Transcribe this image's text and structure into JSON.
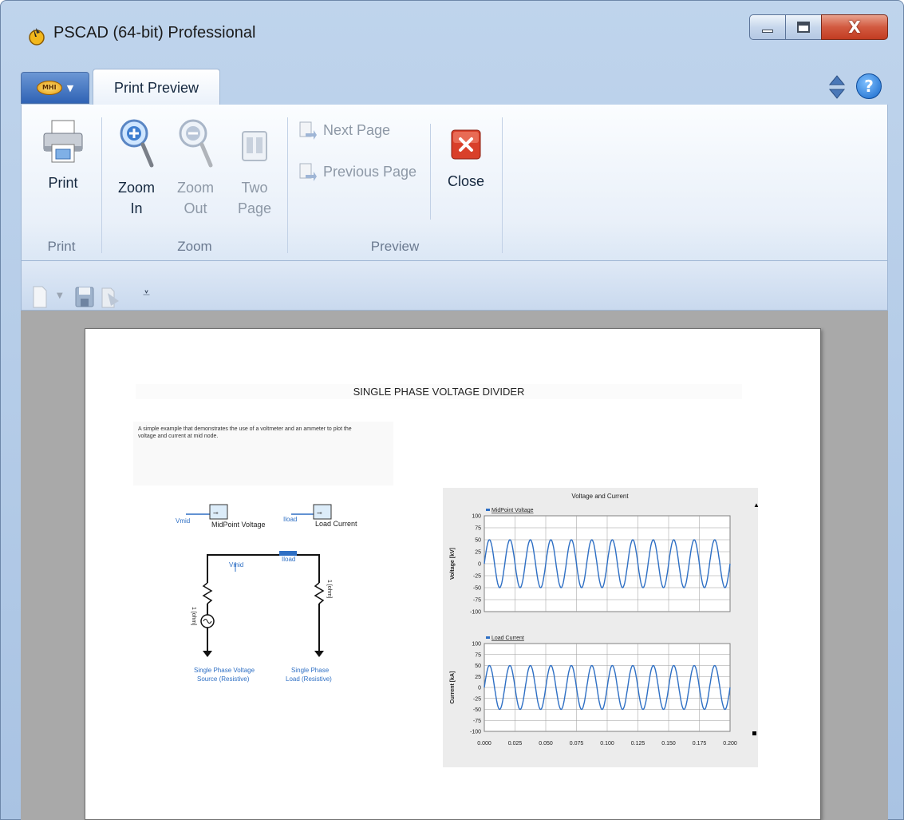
{
  "window": {
    "title": "PSCAD (64-bit) Professional",
    "buttons": {
      "minimize": "minimize",
      "maximize": "maximize",
      "close": "X"
    }
  },
  "ribbon": {
    "app_button": "app-menu",
    "tab": "Print Preview",
    "groups": {
      "print": {
        "label": "Print",
        "print_button": "Print"
      },
      "zoom": {
        "label": "Zoom",
        "zoom_in": [
          "Zoom",
          "In"
        ],
        "zoom_out": [
          "Zoom",
          "Out"
        ],
        "two_page": [
          "Two",
          "Page"
        ]
      },
      "preview": {
        "label": "Preview",
        "next_page": "Next Page",
        "previous_page": "Previous Page",
        "close": "Close"
      }
    }
  },
  "document": {
    "title": "SINGLE PHASE VOLTAGE DIVIDER",
    "description_line1": "A simple example that demonstrates the use of a voltmeter and an ammeter to plot the",
    "description_line2": "voltage and current at mid node.",
    "circuit": {
      "meter1_signal": "Vmid",
      "meter1_label": "MidPoint Voltage",
      "meter2_signal": "Iload",
      "meter2_label": "Load Current",
      "node_v_label": "Vmid",
      "node_i_label": "Iload",
      "r_source_label": "1 [ohm]",
      "r_load_label": "1 [ohm]",
      "source_caption_line1": "Single Phase Voltage",
      "source_caption_line2": "Source (Resistive)",
      "load_caption_line1": "Single Phase",
      "load_caption_line2": "Load (Resistive)"
    }
  },
  "chart_data": {
    "type": "line",
    "title": "Voltage and Current",
    "x_range": [
      0.0,
      0.2
    ],
    "x_ticks": [
      "0.000",
      "0.025",
      "0.050",
      "0.075",
      "0.100",
      "0.125",
      "0.150",
      "0.175",
      "0.200"
    ],
    "grid": true,
    "panels": [
      {
        "ylabel": "Voltage [kV]",
        "legend": "MidPoint Voltage",
        "ylim": [
          -100,
          100
        ],
        "y_ticks": [
          "100",
          "75",
          "50",
          "25",
          "0",
          "-25",
          "-50",
          "-75",
          "-100"
        ],
        "series": [
          {
            "name": "MidPoint Voltage",
            "function": "sine",
            "amplitude": 50,
            "frequency_hz": 60,
            "color": "#2e6fc4"
          }
        ]
      },
      {
        "ylabel": "Current [kA]",
        "legend": "Load Current",
        "ylim": [
          -100,
          100
        ],
        "y_ticks": [
          "100",
          "75",
          "50",
          "25",
          "0",
          "-25",
          "-50",
          "-75",
          "-100"
        ],
        "series": [
          {
            "name": "Load Current",
            "function": "sine",
            "amplitude": 50,
            "frequency_hz": 60,
            "color": "#2e6fc4"
          }
        ]
      }
    ]
  },
  "colors": {
    "accent": "#2e6fc4",
    "ribbon_bg": "#e9f0f9",
    "close_red": "#d9402a"
  }
}
